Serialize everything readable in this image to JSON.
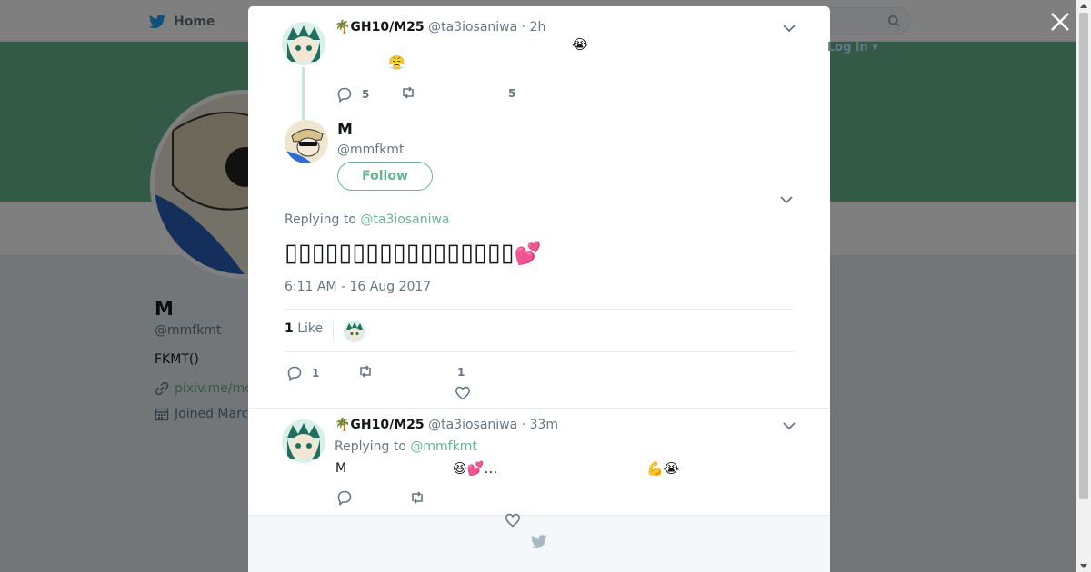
{
  "nav": {
    "home_label": "Home",
    "login_label": "Log in"
  },
  "profile": {
    "name": "M",
    "handle": "@mmfkmt",
    "bio": "FKMT()",
    "link": "pixiv.me/mc",
    "joined": "Joined Marc"
  },
  "parent_tweet": {
    "name": "🌴GH10/M25",
    "handle": "@ta3iosaniwa",
    "time": "· 2h",
    "emoji_1": "😭",
    "emoji_2": "😤",
    "reply_count": "5",
    "like_count": "5"
  },
  "main_tweet": {
    "name": "M",
    "handle": "@mmfkmt",
    "follow_label": "Follow",
    "replying_prefix": "Replying to",
    "replying_to": "@ta3iosaniwa",
    "text": "▯▯▯▯▯▯▯▯▯▯▯▯▯▯▯▯▯",
    "text_emoji": "💕",
    "timestamp": "6:11 AM - 16 Aug 2017",
    "likes_number": "1",
    "likes_label": "Like",
    "reply_count": "1",
    "like_count": "1"
  },
  "reply_tweet": {
    "name": "🌴GH10/M25",
    "handle": "@ta3iosaniwa",
    "time": "· 33m",
    "replying_prefix": "Replying to",
    "replying_to": "@mmfkmt",
    "text_start": "M",
    "text_mid": "😆💕…",
    "text_end": "💪😭"
  },
  "colors": {
    "accent": "#66b58f",
    "muted": "#657786",
    "twitter_blue": "#1da1f2"
  },
  "icons": [
    "twitter-bird-icon",
    "search-icon",
    "close-icon",
    "chevron-down-icon",
    "reply-icon",
    "retweet-icon",
    "heart-icon",
    "link-icon",
    "calendar-icon"
  ]
}
